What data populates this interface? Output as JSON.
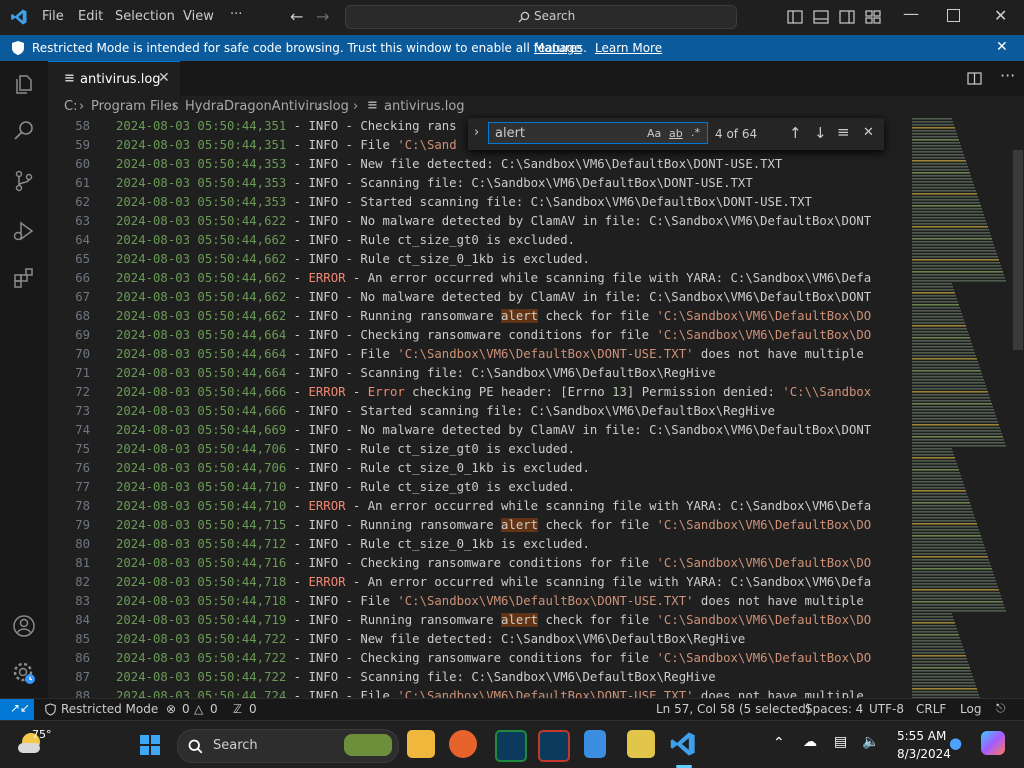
{
  "titlebar": {
    "menu": [
      "File",
      "Edit",
      "Selection",
      "View",
      "···"
    ],
    "search_label": "Search"
  },
  "banner": {
    "message": "Restricted Mode is intended for safe code browsing. Trust this window to enable all features.",
    "manage": "Manage",
    "learn_more": "Learn More"
  },
  "tab": {
    "title": "antivirus.log"
  },
  "breadcrumb": [
    "C:",
    "Program Files",
    "HydraDragonAntivirus",
    "log",
    "antivirus.log"
  ],
  "find": {
    "query": "alert",
    "match_case": "Aa",
    "whole_word": "ab",
    "regex": ".*",
    "count": "4 of 64"
  },
  "lines": [
    {
      "n": "58",
      "ts": "2024-08-03 05:50:44,351",
      "lvl": "INFO",
      "parts": [
        [
          "t",
          "Checking rans"
        ]
      ]
    },
    {
      "n": "59",
      "ts": "2024-08-03 05:50:44,351",
      "lvl": "INFO",
      "parts": [
        [
          "t",
          "File "
        ],
        [
          "s",
          "'C:\\Sand"
        ]
      ]
    },
    {
      "n": "60",
      "ts": "2024-08-03 05:50:44,353",
      "lvl": "INFO",
      "parts": [
        [
          "t",
          "New file detected: C:\\Sandbox\\VM6\\DefaultBox\\DONT-USE.TXT"
        ]
      ]
    },
    {
      "n": "61",
      "ts": "2024-08-03 05:50:44,353",
      "lvl": "INFO",
      "parts": [
        [
          "t",
          "Scanning file: C:\\Sandbox\\VM6\\DefaultBox\\DONT-USE.TXT"
        ]
      ]
    },
    {
      "n": "62",
      "ts": "2024-08-03 05:50:44,353",
      "lvl": "INFO",
      "parts": [
        [
          "t",
          "Started scanning file: C:\\Sandbox\\VM6\\DefaultBox\\DONT-USE.TXT"
        ]
      ]
    },
    {
      "n": "63",
      "ts": "2024-08-03 05:50:44,622",
      "lvl": "INFO",
      "parts": [
        [
          "t",
          "No malware detected by ClamAV in file: C:\\Sandbox\\VM6\\DefaultBox\\DONT"
        ]
      ]
    },
    {
      "n": "64",
      "ts": "2024-08-03 05:50:44,662",
      "lvl": "INFO",
      "parts": [
        [
          "t",
          "Rule ct_size_gt0 is excluded."
        ]
      ]
    },
    {
      "n": "65",
      "ts": "2024-08-03 05:50:44,662",
      "lvl": "INFO",
      "parts": [
        [
          "t",
          "Rule ct_size_0_1kb is excluded."
        ]
      ]
    },
    {
      "n": "66",
      "ts": "2024-08-03 05:50:44,662",
      "lvl": "ERROR",
      "parts": [
        [
          "t",
          "An error occurred while scanning file with YARA: C:\\Sandbox\\VM6\\Defa"
        ]
      ]
    },
    {
      "n": "67",
      "ts": "2024-08-03 05:50:44,662",
      "lvl": "INFO",
      "parts": [
        [
          "t",
          "No malware detected by ClamAV in file: C:\\Sandbox\\VM6\\DefaultBox\\DONT"
        ]
      ]
    },
    {
      "n": "68",
      "ts": "2024-08-03 05:50:44,662",
      "lvl": "INFO",
      "parts": [
        [
          "t",
          "Running ransomware "
        ],
        [
          "h",
          "alert"
        ],
        [
          "t",
          " check for file "
        ],
        [
          "s",
          "'C:\\Sandbox\\VM6\\DefaultBox\\DO"
        ]
      ]
    },
    {
      "n": "69",
      "ts": "2024-08-03 05:50:44,664",
      "lvl": "INFO",
      "parts": [
        [
          "t",
          "Checking ransomware conditions for file "
        ],
        [
          "s",
          "'C:\\Sandbox\\VM6\\DefaultBox\\DO"
        ]
      ]
    },
    {
      "n": "70",
      "ts": "2024-08-03 05:50:44,664",
      "lvl": "INFO",
      "parts": [
        [
          "t",
          "File "
        ],
        [
          "s",
          "'C:\\Sandbox\\VM6\\DefaultBox\\DONT-USE.TXT'"
        ],
        [
          "t",
          " does not have multiple"
        ]
      ]
    },
    {
      "n": "71",
      "ts": "2024-08-03 05:50:44,664",
      "lvl": "INFO",
      "parts": [
        [
          "t",
          "Scanning file: C:\\Sandbox\\VM6\\DefaultBox\\RegHive"
        ]
      ]
    },
    {
      "n": "72",
      "ts": "2024-08-03 05:50:44,666",
      "lvl": "ERROR",
      "parts": [
        [
          "e",
          "Error"
        ],
        [
          "t",
          " checking PE header: [Errno "
        ],
        [
          "n",
          "13"
        ],
        [
          "t",
          "] Permission denied: "
        ],
        [
          "s",
          "'C:\\\\Sandbox"
        ]
      ]
    },
    {
      "n": "73",
      "ts": "2024-08-03 05:50:44,666",
      "lvl": "INFO",
      "parts": [
        [
          "t",
          "Started scanning file: C:\\Sandbox\\VM6\\DefaultBox\\RegHive"
        ]
      ]
    },
    {
      "n": "74",
      "ts": "2024-08-03 05:50:44,669",
      "lvl": "INFO",
      "parts": [
        [
          "t",
          "No malware detected by ClamAV in file: C:\\Sandbox\\VM6\\DefaultBox\\DONT"
        ]
      ]
    },
    {
      "n": "75",
      "ts": "2024-08-03 05:50:44,706",
      "lvl": "INFO",
      "parts": [
        [
          "t",
          "Rule ct_size_gt0 is excluded."
        ]
      ]
    },
    {
      "n": "76",
      "ts": "2024-08-03 05:50:44,706",
      "lvl": "INFO",
      "parts": [
        [
          "t",
          "Rule ct_size_0_1kb is excluded."
        ]
      ]
    },
    {
      "n": "77",
      "ts": "2024-08-03 05:50:44,710",
      "lvl": "INFO",
      "parts": [
        [
          "t",
          "Rule ct_size_gt0 is excluded."
        ]
      ]
    },
    {
      "n": "78",
      "ts": "2024-08-03 05:50:44,710",
      "lvl": "ERROR",
      "parts": [
        [
          "t",
          "An error occurred while scanning file with YARA: C:\\Sandbox\\VM6\\Defa"
        ]
      ]
    },
    {
      "n": "79",
      "ts": "2024-08-03 05:50:44,715",
      "lvl": "INFO",
      "parts": [
        [
          "t",
          "Running ransomware "
        ],
        [
          "h",
          "alert"
        ],
        [
          "t",
          " check for file "
        ],
        [
          "s",
          "'C:\\Sandbox\\VM6\\DefaultBox\\DO"
        ]
      ]
    },
    {
      "n": "80",
      "ts": "2024-08-03 05:50:44,712",
      "lvl": "INFO",
      "parts": [
        [
          "t",
          "Rule ct_size_0_1kb is excluded."
        ]
      ]
    },
    {
      "n": "81",
      "ts": "2024-08-03 05:50:44,716",
      "lvl": "INFO",
      "parts": [
        [
          "t",
          "Checking ransomware conditions for file "
        ],
        [
          "s",
          "'C:\\Sandbox\\VM6\\DefaultBox\\DO"
        ]
      ]
    },
    {
      "n": "82",
      "ts": "2024-08-03 05:50:44,718",
      "lvl": "ERROR",
      "parts": [
        [
          "t",
          "An error occurred while scanning file with YARA: C:\\Sandbox\\VM6\\Defa"
        ]
      ]
    },
    {
      "n": "83",
      "ts": "2024-08-03 05:50:44,718",
      "lvl": "INFO",
      "parts": [
        [
          "t",
          "File "
        ],
        [
          "s",
          "'C:\\Sandbox\\VM6\\DefaultBox\\DONT-USE.TXT'"
        ],
        [
          "t",
          " does not have multiple"
        ]
      ]
    },
    {
      "n": "84",
      "ts": "2024-08-03 05:50:44,719",
      "lvl": "INFO",
      "parts": [
        [
          "t",
          "Running ransomware "
        ],
        [
          "h",
          "alert"
        ],
        [
          "t",
          " check for file "
        ],
        [
          "s",
          "'C:\\Sandbox\\VM6\\DefaultBox\\DO"
        ]
      ]
    },
    {
      "n": "85",
      "ts": "2024-08-03 05:50:44,722",
      "lvl": "INFO",
      "parts": [
        [
          "t",
          "New file detected: C:\\Sandbox\\VM6\\DefaultBox\\RegHive"
        ]
      ]
    },
    {
      "n": "86",
      "ts": "2024-08-03 05:50:44,722",
      "lvl": "INFO",
      "parts": [
        [
          "t",
          "Checking ransomware conditions for file "
        ],
        [
          "s",
          "'C:\\Sandbox\\VM6\\DefaultBox\\DO"
        ]
      ]
    },
    {
      "n": "87",
      "ts": "2024-08-03 05:50:44,722",
      "lvl": "INFO",
      "parts": [
        [
          "t",
          "Scanning file: C:\\Sandbox\\VM6\\DefaultBox\\RegHive"
        ]
      ]
    },
    {
      "n": "88",
      "ts": "2024-08-03 05:50:44,724",
      "lvl": "INFO",
      "parts": [
        [
          "t",
          "File "
        ],
        [
          "s",
          "'C:\\Sandbox\\VM6\\DefaultBox\\DONT-USE.TXT'"
        ],
        [
          "t",
          " does not have multiple"
        ]
      ]
    }
  ],
  "status": {
    "restricted": "Restricted Mode",
    "errors": "0",
    "warnings": "0",
    "ports": "0",
    "cursor": "Ln 57, Col 58 (5 selected)",
    "spaces": "Spaces: 4",
    "encoding": "UTF-8",
    "eol": "CRLF",
    "language": "Log"
  },
  "taskbar": {
    "weather": "75°",
    "search": "Search",
    "time": "5:55 AM",
    "date": "8/3/2024"
  },
  "colors": {
    "accent": "#0078d4",
    "banner": "#0a5a9c",
    "timestamp": "#6a9955",
    "error": "#f48771",
    "string": "#ce9178",
    "highlight": "#623315"
  }
}
